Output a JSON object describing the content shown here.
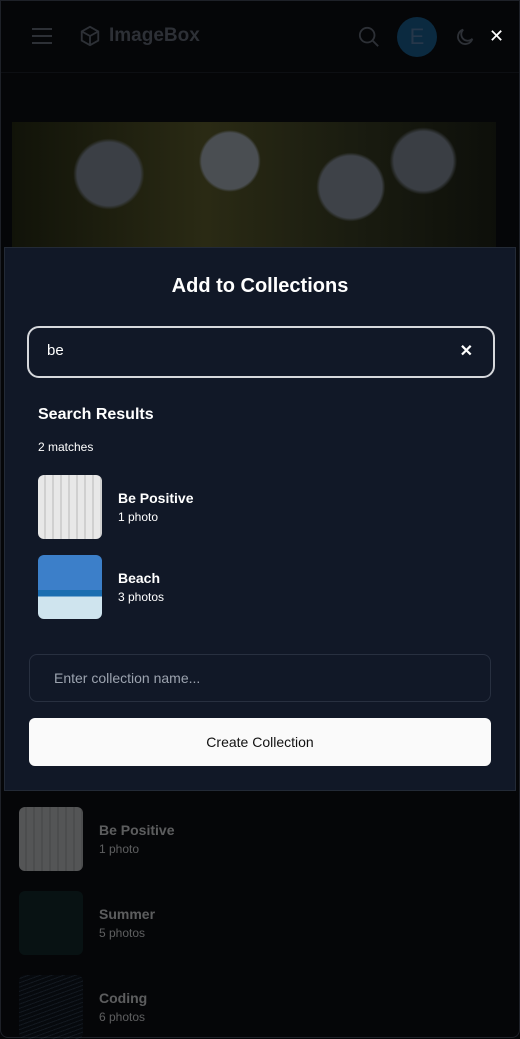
{
  "header": {
    "logo": "ImageBox",
    "avatar_initial": "E"
  },
  "modal": {
    "title": "Add to Collections",
    "search_value": "be",
    "results_heading": "Search Results",
    "match_count": "2 matches",
    "results": [
      {
        "name": "Be Positive",
        "count": "1 photo"
      },
      {
        "name": "Beach",
        "count": "3 photos"
      }
    ],
    "new_collection_placeholder": "Enter collection name...",
    "create_label": "Create Collection"
  },
  "background_list": [
    {
      "name": "Be Positive",
      "count": "1 photo"
    },
    {
      "name": "Summer",
      "count": "5 photos"
    },
    {
      "name": "Coding",
      "count": "6 photos"
    }
  ]
}
